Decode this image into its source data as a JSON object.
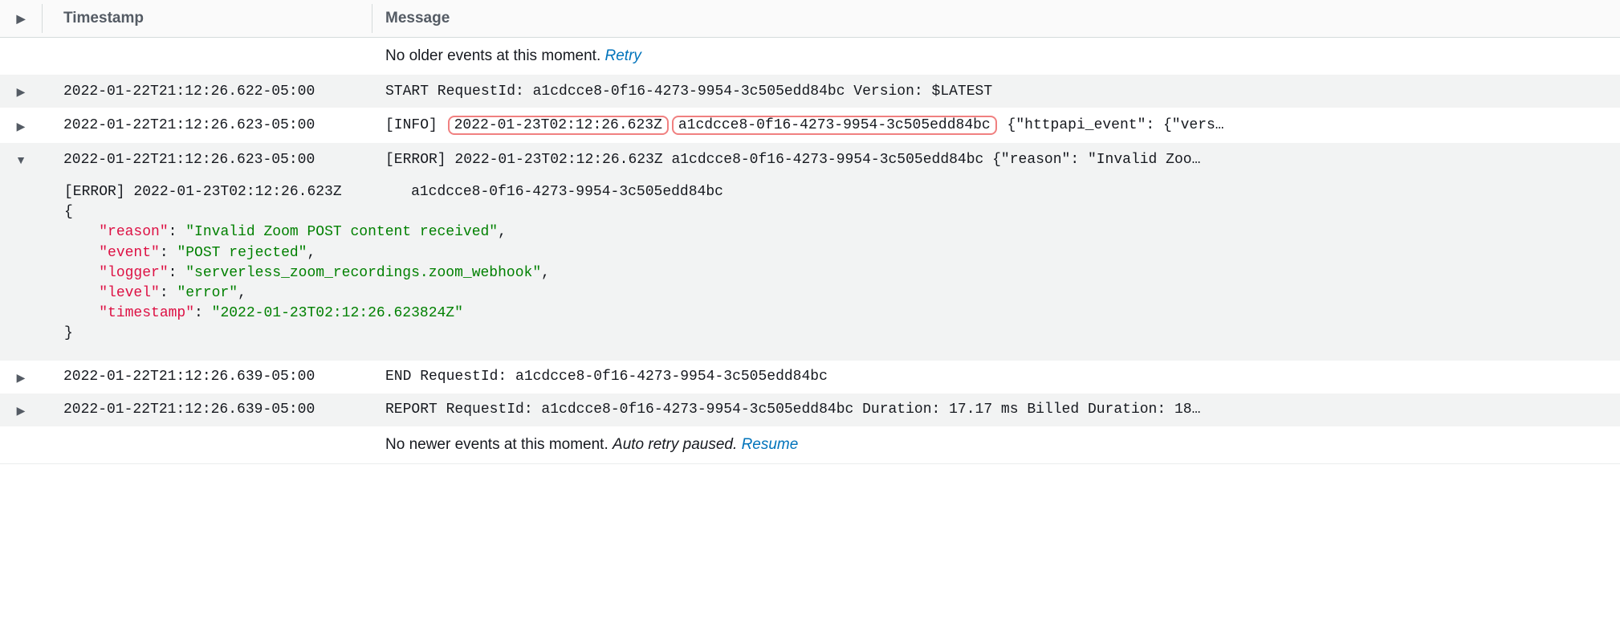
{
  "header": {
    "timestamp_label": "Timestamp",
    "message_label": "Message"
  },
  "status": {
    "older_msg": "No older events at this moment. ",
    "older_link": "Retry",
    "newer_msg": "No newer events at this moment. ",
    "newer_paused": "Auto retry paused.",
    "newer_link": "Resume"
  },
  "rows": [
    {
      "ts": "2022-01-22T21:12:26.622-05:00",
      "msg": "START RequestId: a1cdcce8-0f16-4273-9954-3c505edd84bc Version: $LATEST"
    },
    {
      "ts": "2022-01-22T21:12:26.623-05:00",
      "msg_prefix": "[INFO]",
      "msg_hl1": "2022-01-23T02:12:26.623Z",
      "msg_hl2": "a1cdcce8-0f16-4273-9954-3c505edd84bc",
      "msg_suffix": " {\"httpapi_event\": {\"vers…"
    },
    {
      "ts": "2022-01-22T21:12:26.623-05:00",
      "msg": "[ERROR] 2022-01-23T02:12:26.623Z a1cdcce8-0f16-4273-9954-3c505edd84bc {\"reason\": \"Invalid Zoo…"
    },
    {
      "ts": "2022-01-22T21:12:26.639-05:00",
      "msg": "END RequestId: a1cdcce8-0f16-4273-9954-3c505edd84bc"
    },
    {
      "ts": "2022-01-22T21:12:26.639-05:00",
      "msg": "REPORT RequestId: a1cdcce8-0f16-4273-9954-3c505edd84bc Duration: 17.17 ms Billed Duration: 18…"
    }
  ],
  "expanded": {
    "header_line": "[ERROR] 2022-01-23T02:12:26.623Z        a1cdcce8-0f16-4273-9954-3c505edd84bc",
    "json": {
      "reason_k": "\"reason\"",
      "reason_v": "\"Invalid Zoom POST content received\"",
      "event_k": "\"event\"",
      "event_v": "\"POST rejected\"",
      "logger_k": "\"logger\"",
      "logger_v": "\"serverless_zoom_recordings.zoom_webhook\"",
      "level_k": "\"level\"",
      "level_v": "\"error\"",
      "timestamp_k": "\"timestamp\"",
      "timestamp_v": "\"2022-01-23T02:12:26.623824Z\""
    }
  }
}
